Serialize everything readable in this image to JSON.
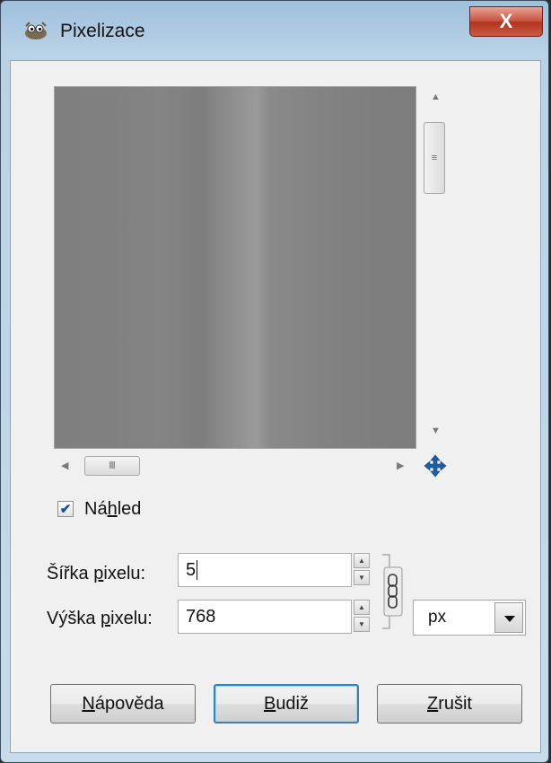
{
  "window": {
    "title": "Pixelizace",
    "close_label": "X"
  },
  "preview": {
    "vscroll_grip": "≡",
    "hscroll_grip": "Ⅲ"
  },
  "preview_checkbox": {
    "label_before": "Ná",
    "label_mnemonic": "h",
    "label_after": "led",
    "checked": true,
    "check_mark": "✔"
  },
  "width_field": {
    "label_before": "Šířka ",
    "label_mnemonic": "p",
    "label_after": "ixelu:",
    "value": "5"
  },
  "height_field": {
    "label_before": "Výška ",
    "label_mnemonic": "p",
    "label_after": "ixelu:",
    "value": "768"
  },
  "unit_select": {
    "value": "px"
  },
  "buttons": {
    "help": {
      "mnemonic": "N",
      "rest": "ápověda"
    },
    "ok": {
      "mnemonic": "B",
      "rest": "udiž"
    },
    "cancel": {
      "mnemonic": "Z",
      "rest": "rušit"
    }
  }
}
